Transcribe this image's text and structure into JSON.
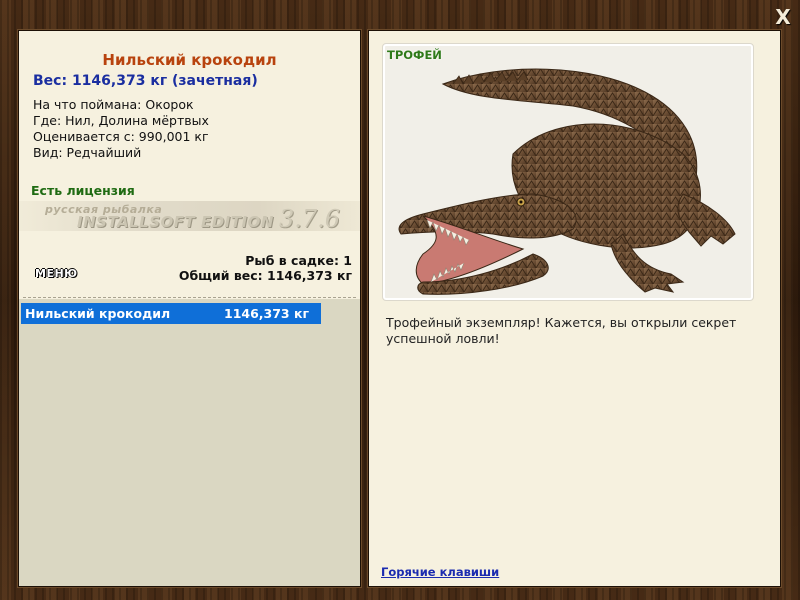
{
  "window": {
    "close_glyph": "X"
  },
  "fish": {
    "title": "Нильский крокодил",
    "weight_line": "Вес: 1146,373 кг (зачетная)",
    "bait": "На что поймана: Окорок",
    "place": "Где: Нил, Долина мёртвых",
    "valued_from": "Оценивается с: 990,001 кг",
    "kind": "Вид: Редчайший"
  },
  "license_text": "Есть лицензия",
  "logo": {
    "small": "русская рыбалка",
    "main": "INSTALLSOFT EDITION",
    "version": "3.7.6"
  },
  "cage": {
    "count_line": "Рыб в садке: 1",
    "total_line": "Общий вес: 1146,373 кг"
  },
  "menu_label": "МЕНЮ",
  "catch_list": [
    {
      "name": "Нильский крокодил",
      "weight": "1146,373 кг"
    }
  ],
  "trophy": {
    "label": "ТРОФЕЙ",
    "description": "Трофейный экземпляр! Кажется, вы открыли секрет успешной ловли!"
  },
  "hotkeys_link": "Горячие клавиши",
  "colors": {
    "title": "#b8430e",
    "weight": "#1a2ea0",
    "license": "#1f6b12",
    "selection": "#0f6fd8",
    "link": "#1b2bb0"
  }
}
